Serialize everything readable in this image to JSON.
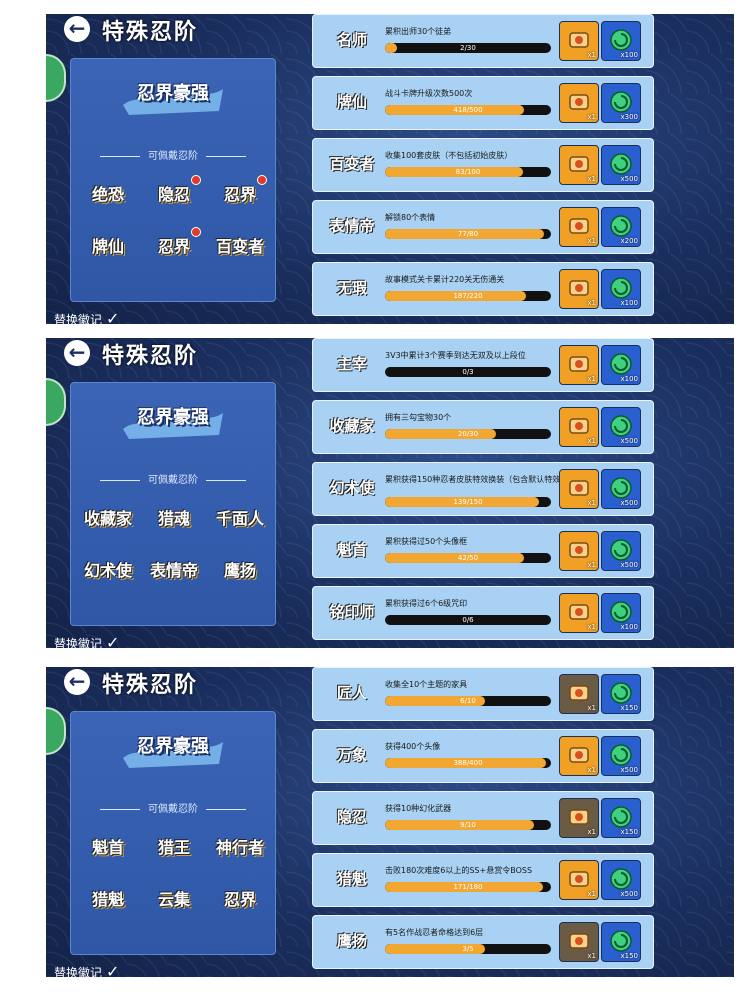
{
  "panels": [
    {
      "title": "特殊忍阶",
      "left": {
        "big_badge": "忍界豪强",
        "section_title": "可佩戴忍阶",
        "badges": [
          {
            "label": "绝恐",
            "dot": false
          },
          {
            "label": "隐忍",
            "dot": true
          },
          {
            "label": "忍界",
            "dot": true
          },
          {
            "label": "牌仙",
            "dot": false
          },
          {
            "label": "忍界",
            "dot": true
          },
          {
            "label": "百变者",
            "dot": false
          }
        ],
        "replace_label": "替换徽记"
      },
      "rows": [
        {
          "badge": "名师",
          "task": "累积出师30个徒弟",
          "progress": "2/30",
          "fill": 0.07,
          "scroll_count": "x1",
          "swirl_count": "x100",
          "scroll_style": "orange"
        },
        {
          "badge": "牌仙",
          "task": "战斗卡牌升级次数500次",
          "progress": "418/500",
          "fill": 0.84,
          "scroll_count": "x1",
          "swirl_count": "x300",
          "scroll_style": "orange"
        },
        {
          "badge": "百变者",
          "task": "收集100套皮肤（不包括初始皮肤）",
          "progress": "83/100",
          "fill": 0.83,
          "scroll_count": "x1",
          "swirl_count": "x500",
          "scroll_style": "orange"
        },
        {
          "badge": "表情帝",
          "task": "解锁80个表情",
          "progress": "77/80",
          "fill": 0.96,
          "scroll_count": "x1",
          "swirl_count": "x200",
          "scroll_style": "orange"
        },
        {
          "badge": "无瑕",
          "task": "故事模式关卡累计220关无伤通关",
          "progress": "187/220",
          "fill": 0.85,
          "scroll_count": "x1",
          "swirl_count": "x100",
          "scroll_style": "orange"
        }
      ]
    },
    {
      "title": "特殊忍阶",
      "left": {
        "big_badge": "忍界豪强",
        "section_title": "可佩戴忍阶",
        "badges": [
          {
            "label": "收藏家",
            "dot": false
          },
          {
            "label": "猎魂",
            "dot": false
          },
          {
            "label": "千面人",
            "dot": false
          },
          {
            "label": "幻术使",
            "dot": false
          },
          {
            "label": "表情帝",
            "dot": false
          },
          {
            "label": "鹰扬",
            "dot": false
          }
        ],
        "replace_label": "替换徽记"
      },
      "rows": [
        {
          "badge": "主宰",
          "task": "3V3中累计3个赛季到达无双及以上段位",
          "progress": "0/3",
          "fill": 0.0,
          "scroll_count": "x1",
          "swirl_count": "x100",
          "scroll_style": "orange"
        },
        {
          "badge": "收藏家",
          "task": "拥有三勾宝物30个",
          "progress": "20/30",
          "fill": 0.67,
          "scroll_count": "x1",
          "swirl_count": "x500",
          "scroll_style": "orange"
        },
        {
          "badge": "幻术使",
          "task": "累积获得150种忍者皮肤特效换装（包含默认特效）",
          "progress": "139/150",
          "fill": 0.93,
          "scroll_count": "x1",
          "swirl_count": "x500",
          "scroll_style": "orange"
        },
        {
          "badge": "魁首",
          "task": "累积获得过50个头像框",
          "progress": "42/50",
          "fill": 0.84,
          "scroll_count": "x1",
          "swirl_count": "x500",
          "scroll_style": "orange"
        },
        {
          "badge": "铭印师",
          "task": "累积获得过6个6级咒印",
          "progress": "0/6",
          "fill": 0.0,
          "scroll_count": "x1",
          "swirl_count": "x100",
          "scroll_style": "orange"
        }
      ]
    },
    {
      "title": "特殊忍阶",
      "left": {
        "big_badge": "忍界豪强",
        "section_title": "可佩戴忍阶",
        "badges": [
          {
            "label": "魁首",
            "dot": false
          },
          {
            "label": "猎王",
            "dot": false
          },
          {
            "label": "神行者",
            "dot": false
          },
          {
            "label": "猎魁",
            "dot": false
          },
          {
            "label": "云集",
            "dot": false
          },
          {
            "label": "忍界",
            "dot": false
          }
        ],
        "replace_label": "替换徽记"
      },
      "rows": [
        {
          "badge": "匠人",
          "task": "收集全10个主题的家具",
          "progress": "6/10",
          "fill": 0.6,
          "scroll_count": "x1",
          "swirl_count": "x150",
          "scroll_style": "cream"
        },
        {
          "badge": "万象",
          "task": "获得400个头像",
          "progress": "388/400",
          "fill": 0.97,
          "scroll_count": "x1",
          "swirl_count": "x500",
          "scroll_style": "orange"
        },
        {
          "badge": "隐忍",
          "task": "获得10种幻化武器",
          "progress": "9/10",
          "fill": 0.9,
          "scroll_count": "x1",
          "swirl_count": "x150",
          "scroll_style": "cream"
        },
        {
          "badge": "猎魁",
          "task": "击败180次难度6以上的SS+悬赏令BOSS",
          "progress": "171/180",
          "fill": 0.95,
          "scroll_count": "x1",
          "swirl_count": "x500",
          "scroll_style": "orange"
        },
        {
          "badge": "鹰扬",
          "task": "有5名作战忍者命格达到6层",
          "progress": "3/5",
          "fill": 0.6,
          "scroll_count": "x1",
          "swirl_count": "x150",
          "scroll_style": "cream"
        }
      ]
    }
  ]
}
